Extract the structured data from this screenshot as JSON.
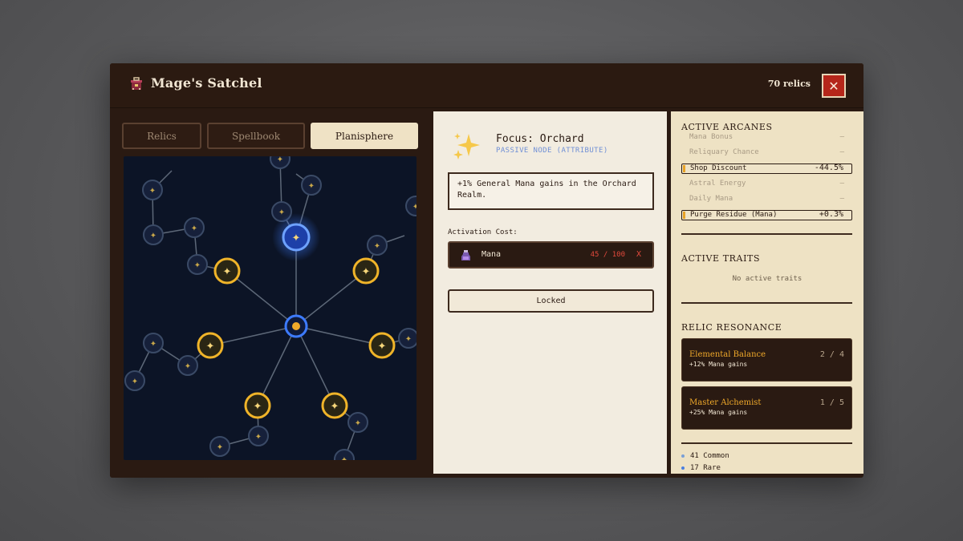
{
  "header": {
    "title": "Mage's Satchel",
    "relic_count": "70 relics",
    "close_label": "✕"
  },
  "tabs": [
    {
      "label": "Relics",
      "active": false
    },
    {
      "label": "Spellbook",
      "active": false
    },
    {
      "label": "Planisphere",
      "active": true
    }
  ],
  "node": {
    "title": "Focus: Orchard",
    "subtitle": "PASSIVE NODE (ATTRIBUTE)",
    "description": "+1% General Mana gains in the Orchard Realm.",
    "cost_label": "Activation Cost:",
    "cost_resource": "Mana",
    "cost_value": "45 / 100",
    "cost_status": "X",
    "action_label": "Locked"
  },
  "arcanes": {
    "title": "ACTIVE ARCANES",
    "rows": [
      {
        "name": "Mana Bonus",
        "value": "—",
        "active": false
      },
      {
        "name": "Reliquary Chance",
        "value": "—",
        "active": false
      },
      {
        "name": "Shop Discount",
        "value": "-44.5%",
        "active": true
      },
      {
        "name": "Astral Energy",
        "value": "—",
        "active": false
      },
      {
        "name": "Daily Mana",
        "value": "—",
        "active": false
      },
      {
        "name": "Purge Residue (Mana)",
        "value": "+0.3%",
        "active": true
      }
    ]
  },
  "traits": {
    "title": "ACTIVE TRAITS",
    "empty": "No active traits"
  },
  "resonance": {
    "title": "RELIC RESONANCE",
    "cards": [
      {
        "name": "Elemental Balance",
        "count": "2 / 4",
        "effect": "+12% Mana gains"
      },
      {
        "name": "Master Alchemist",
        "count": "1 / 5",
        "effect": "+25% Mana gains"
      }
    ]
  },
  "rarity": [
    {
      "label": "41 Common",
      "color": "#7a9fd6"
    },
    {
      "label": "17 Rare",
      "color": "#4a7fe0"
    }
  ],
  "colors": {
    "accent_gold": "#f0a92a",
    "selected_blue": "#3d7bff",
    "danger_red": "#b5261a"
  }
}
